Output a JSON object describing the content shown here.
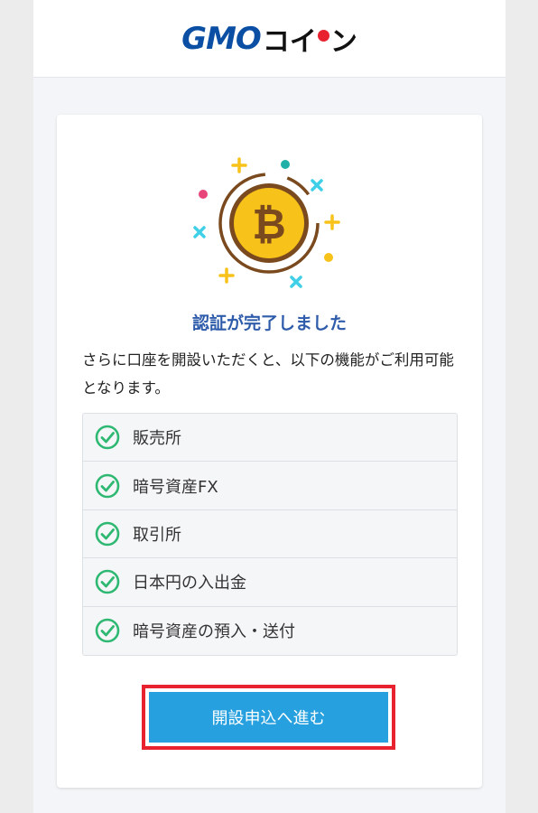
{
  "header": {
    "logo_gmo": "GMO",
    "logo_coin_a": "コイ",
    "logo_coin_b": "ン"
  },
  "card": {
    "title": "認証が完了しました",
    "description": "さらに口座を開設いただくと、以下の機能がご利用可能となります。",
    "features": [
      {
        "label": "販売所",
        "icon": "check-circle-icon"
      },
      {
        "label": "暗号資産FX",
        "icon": "check-circle-icon"
      },
      {
        "label": "取引所",
        "icon": "check-circle-icon"
      },
      {
        "label": "日本円の入出金",
        "icon": "check-circle-icon"
      },
      {
        "label": "暗号資産の預入・送付",
        "icon": "check-circle-icon"
      }
    ],
    "cta_label": "開設申込へ進む"
  },
  "colors": {
    "brand_blue": "#0a4fa3",
    "title_blue": "#2f5caa",
    "button_blue": "#26a0de",
    "check_green": "#2eb872",
    "highlight_red": "#e8222e",
    "coin_gold": "#f7c21a"
  },
  "illustration": {
    "icon": "bitcoin-coin-icon"
  }
}
